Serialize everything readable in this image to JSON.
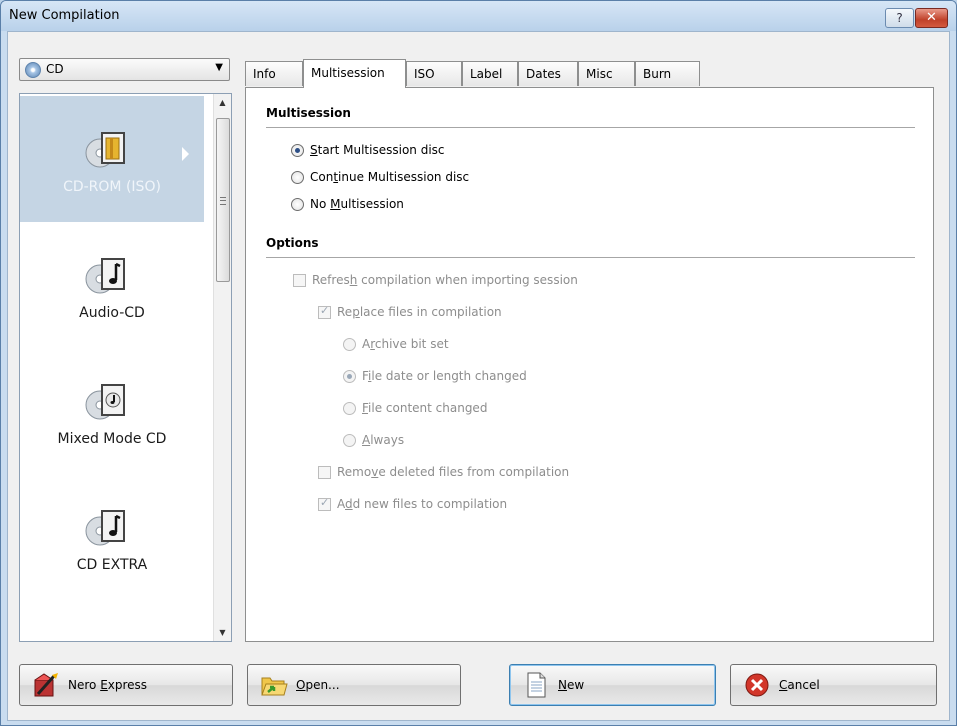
{
  "window": {
    "title": "New Compilation",
    "help_label": "?",
    "close_label": "✕"
  },
  "disc_type_dropdown": {
    "value": "CD"
  },
  "compilation_types": [
    {
      "label": "CD-ROM (ISO)",
      "icon": "cd-rom-iso-icon",
      "selected": true
    },
    {
      "label": "Audio-CD",
      "icon": "audio-cd-icon"
    },
    {
      "label": "Mixed Mode CD",
      "icon": "mixed-mode-cd-icon"
    },
    {
      "label": "CD EXTRA",
      "icon": "cd-extra-icon"
    }
  ],
  "tabs": [
    "Info",
    "Multisession",
    "ISO",
    "Label",
    "Dates",
    "Misc",
    "Burn"
  ],
  "active_tab": "Multisession",
  "multisession": {
    "heading": "Multisession",
    "options": [
      {
        "pre": "",
        "key": "S",
        "post": "tart Multisession disc",
        "checked": true
      },
      {
        "pre": "Con",
        "key": "t",
        "post": "inue Multisession disc",
        "checked": false
      },
      {
        "pre": "No ",
        "key": "M",
        "post": "ultisession",
        "checked": false
      }
    ]
  },
  "options": {
    "heading": "Options",
    "refresh": {
      "pre": "Refres",
      "key": "h",
      "post": " compilation when importing session",
      "checked": false
    },
    "replace": {
      "pre": "Re",
      "key": "p",
      "post": "lace files in compilation",
      "checked": true
    },
    "replace_modes": [
      {
        "pre": "A",
        "key": "r",
        "post": "chive bit set",
        "checked": false
      },
      {
        "pre": "F",
        "key": "i",
        "post": "le date or length changed",
        "checked": true
      },
      {
        "pre": "",
        "key": "F",
        "post": "ile content changed",
        "checked": false
      },
      {
        "pre": "",
        "key": "A",
        "post": "lways",
        "checked": false
      }
    ],
    "remove_deleted": {
      "pre": "Remo",
      "key": "v",
      "post": "e deleted files from compilation",
      "checked": false
    },
    "add_new": {
      "pre": "A",
      "key": "d",
      "post": "d new files to compilation",
      "checked": true
    }
  },
  "buttons": {
    "nero_express": {
      "pre": "Nero ",
      "key": "E",
      "post": "xpress"
    },
    "open": {
      "pre": "",
      "key": "O",
      "post": "pen..."
    },
    "new": {
      "pre": "",
      "key": "N",
      "post": "ew"
    },
    "cancel": {
      "pre": "",
      "key": "C",
      "post": "ancel"
    }
  },
  "colors": {
    "title_bar": "#c4d9ef",
    "selection": "#c5d5e4",
    "close_button": "#c0412a"
  }
}
